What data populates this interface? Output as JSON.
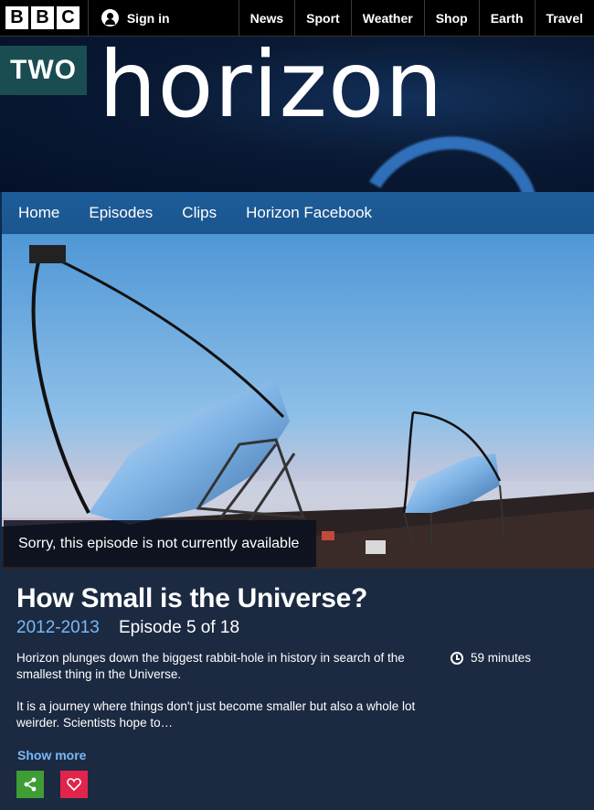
{
  "bbc": {
    "logo_letters": [
      "B",
      "B",
      "C"
    ],
    "sign_in": "Sign in",
    "nav": [
      "News",
      "Sport",
      "Weather",
      "Shop",
      "Earth",
      "Travel"
    ]
  },
  "brand": {
    "channel": "TWO",
    "title": "horizon"
  },
  "programme_nav": [
    "Home",
    "Episodes",
    "Clips",
    "Horizon Facebook"
  ],
  "hero": {
    "unavailable_message": "Sorry, this episode is not currently available"
  },
  "episode": {
    "title": "How Small is the Universe?",
    "series": "2012-2013",
    "episode_label": "Episode 5 of 18",
    "description_1": "Horizon plunges down the biggest rabbit-hole in history in search of the smallest thing in the Universe.",
    "description_2": "It is a journey where things don't just become smaller but also a whole lot weirder. Scientists hope to…",
    "duration": "59 minutes",
    "show_more": "Show more"
  },
  "icons": {
    "share": "share-icon",
    "favourite": "heart-icon",
    "clock": "clock-icon",
    "user": "user-icon"
  },
  "colors": {
    "share_button": "#3f9d35",
    "favourite_button": "#e0244c",
    "link_blue": "#7ab8f5",
    "nav_blue": "#1e5d99"
  }
}
